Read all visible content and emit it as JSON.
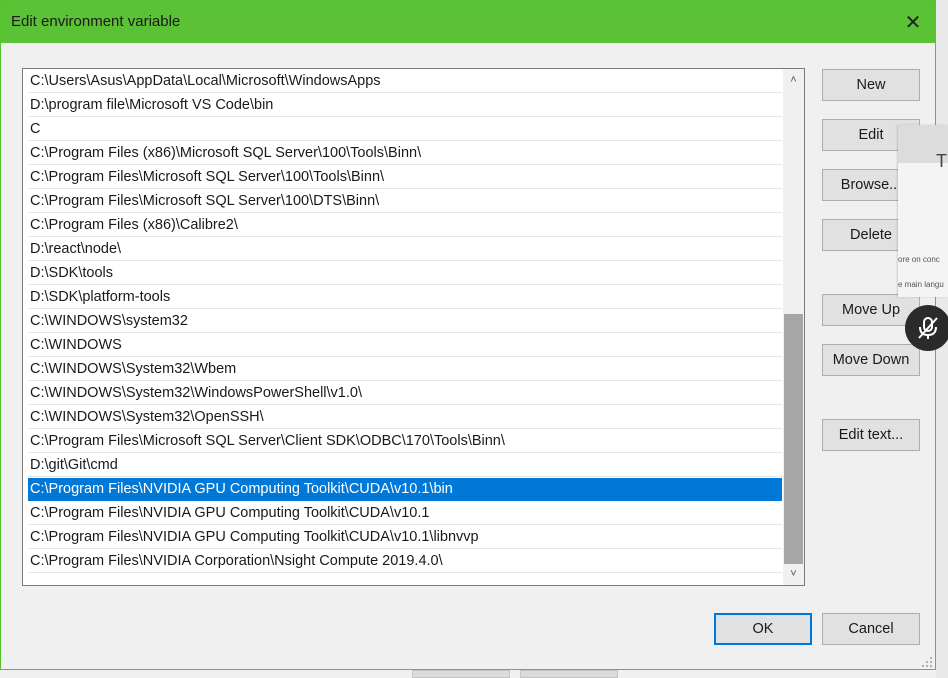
{
  "window": {
    "title": "Edit environment variable",
    "close_glyph": "✕"
  },
  "paths": [
    "C:\\Users\\Asus\\AppData\\Local\\Microsoft\\WindowsApps",
    "D:\\program file\\Microsoft VS Code\\bin",
    "C",
    "C:\\Program Files (x86)\\Microsoft SQL Server\\100\\Tools\\Binn\\",
    "C:\\Program Files\\Microsoft SQL Server\\100\\Tools\\Binn\\",
    "C:\\Program Files\\Microsoft SQL Server\\100\\DTS\\Binn\\",
    "C:\\Program Files (x86)\\Calibre2\\",
    "D:\\react\\node\\",
    "D:\\SDK\\tools",
    "D:\\SDK\\platform-tools",
    "C:\\WINDOWS\\system32",
    "C:\\WINDOWS",
    "C:\\WINDOWS\\System32\\Wbem",
    "C:\\WINDOWS\\System32\\WindowsPowerShell\\v1.0\\",
    "C:\\WINDOWS\\System32\\OpenSSH\\",
    "C:\\Program Files\\Microsoft SQL Server\\Client SDK\\ODBC\\170\\Tools\\Binn\\",
    "D:\\git\\Git\\cmd",
    "C:\\Program Files\\NVIDIA GPU Computing Toolkit\\CUDA\\v10.1\\bin",
    "C:\\Program Files\\NVIDIA GPU Computing Toolkit\\CUDA\\v10.1",
    "C:\\Program Files\\NVIDIA GPU Computing Toolkit\\CUDA\\v10.1\\libnvvp",
    "C:\\Program Files\\NVIDIA Corporation\\Nsight Compute 2019.4.0\\"
  ],
  "selected_index": 17,
  "buttons": {
    "new": "New",
    "edit": "Edit",
    "browse": "Browse...",
    "delete": "Delete",
    "move_up": "Move Up",
    "move_down": "Move Down",
    "edit_text": "Edit text...",
    "ok": "OK",
    "cancel": "Cancel"
  },
  "overlay": {
    "letter": "T",
    "text1": "ore on conc",
    "text2": "e main langu",
    "icon": "mic-muted-icon"
  },
  "colors": {
    "titlebar": "#5bc236",
    "selection": "#0078d7",
    "ok_border": "#0078d7"
  }
}
